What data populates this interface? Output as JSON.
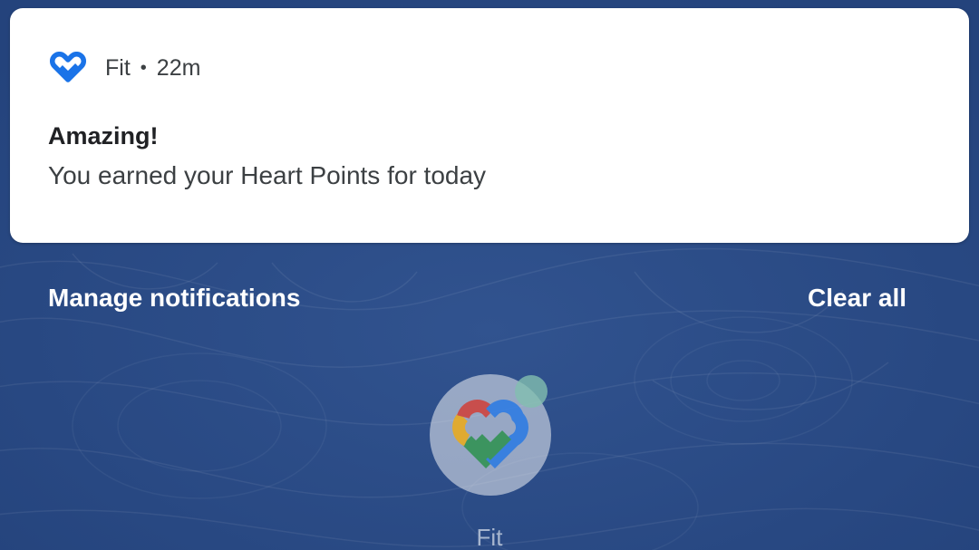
{
  "notification": {
    "app_icon": "google-fit-heart-icon",
    "app_name": "Fit",
    "separator": "•",
    "time_ago": "22m",
    "title": "Amazing!",
    "body": "You earned your Heart Points for today"
  },
  "actions": {
    "manage_label": "Manage notifications",
    "clear_label": "Clear all"
  },
  "home": {
    "app_icon": "google-fit-logo-icon",
    "app_label": "Fit"
  },
  "colors": {
    "background": "#2a4b87",
    "fit_blue": "#1a73e8",
    "fit_red": "#d93025",
    "fit_yellow": "#f9ab00",
    "fit_green": "#1e8e3e"
  }
}
